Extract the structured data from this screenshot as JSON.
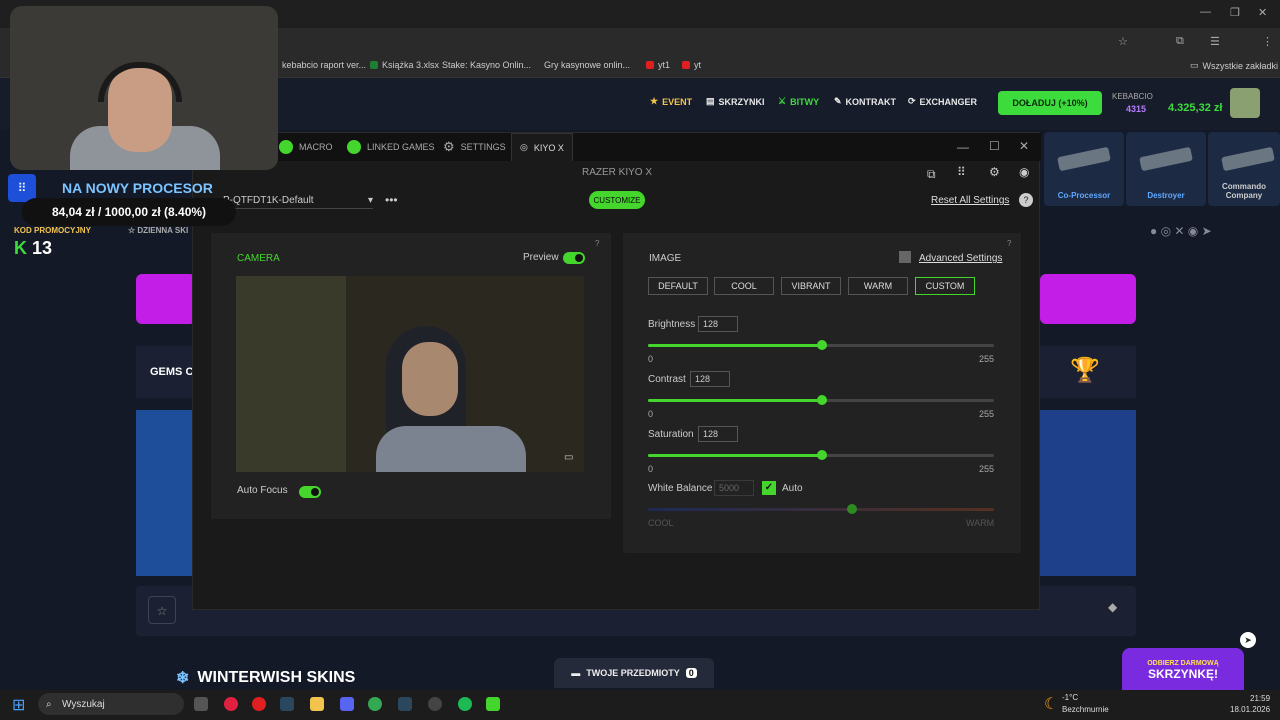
{
  "bookmarks": [
    "kebabcio raport ver...",
    "Książka 3.xlsx",
    "Stake: Kasyno Onlin...",
    "Gry kasynowe onlin...",
    "yt1",
    "yt",
    "Wszystkie zakładki"
  ],
  "site_nav": {
    "event": "EVENT",
    "skrzynki": "SKRZYNKI",
    "bitwy": "BITWY",
    "kontrakt": "KONTRAKT",
    "exchanger": "EXCHANGER",
    "doladuj": "DOŁADUJ (+10%)",
    "username": "KEBABCIO",
    "level": "4315",
    "balance": "4.325,32 zł"
  },
  "skins": [
    "Co-Processor",
    "Destroyer",
    "Commando Company"
  ],
  "site_texts": {
    "dzienna": "DZIENNA SKI",
    "gems": "GEMS C",
    "winterwish": "WINTERWISH SKINS",
    "items_button": "TWOJE PRZEDMIOTY",
    "items_count": "0",
    "promo_line1": "ODBIERZ DARMOWĄ",
    "promo_line2": "SKRZYNKĘ!"
  },
  "overlay": {
    "title": "NA NOWY PROCESOR",
    "progress_text": "84,04 zł / 1000,00 zł (8.40%)",
    "code_label": "KOD PROMOCYJNY",
    "code_value": "13"
  },
  "razer": {
    "tabs": [
      "MACRO",
      "LINKED GAMES",
      "SETTINGS",
      "KIYO X"
    ],
    "title": "RAZER KIYO X",
    "profile": "P-QTFDT1K-Default",
    "customize": "CUSTOMIZE",
    "reset": "Reset All Settings",
    "camera_label": "CAMERA",
    "preview_label": "Preview",
    "auto_focus": "Auto Focus",
    "image_label": "IMAGE",
    "advanced": "Advanced Settings",
    "presets": [
      "DEFAULT",
      "COOL",
      "VIBRANT",
      "WARM",
      "CUSTOM"
    ],
    "brightness": {
      "label": "Brightness",
      "value": "128",
      "min": "0",
      "max": "255"
    },
    "contrast": {
      "label": "Contrast",
      "value": "128",
      "min": "0",
      "max": "255"
    },
    "saturation": {
      "label": "Saturation",
      "value": "128",
      "min": "0",
      "max": "255"
    },
    "white_balance": {
      "label": "White Balance",
      "value": "5000",
      "auto": "Auto",
      "cool": "COOL",
      "warm": "WARM"
    }
  },
  "taskbar": {
    "search": "Wyszukaj",
    "weather_temp": "-1°C",
    "weather_desc": "Bezchmurnie",
    "time": "21:59",
    "date": "18.01.2026"
  },
  "colors": {
    "accent": "#44d62c",
    "site_bg": "#141927",
    "brand_blue": "#5fa8ff"
  }
}
